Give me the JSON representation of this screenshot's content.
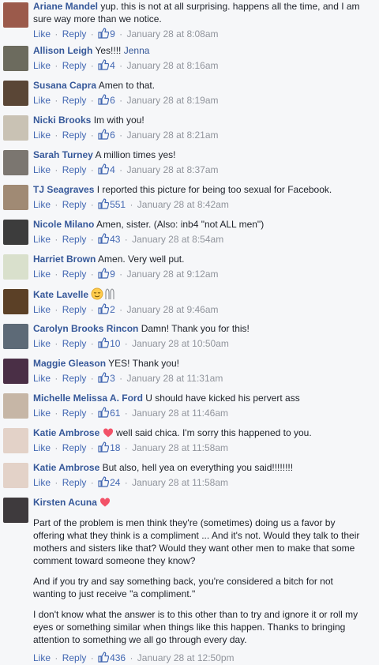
{
  "actions": {
    "like": "Like",
    "reply": "Reply",
    "sep": "·"
  },
  "comments": [
    {
      "author": "Ariane Mandel",
      "text": "yup. this is not at all surprising. happens all the time, and I am sure way more than we notice.",
      "likes": "9",
      "time": "January 28 at 8:08am",
      "avatar": "#9b5a4b"
    },
    {
      "author": "Allison Leigh",
      "text": "Yes!!!!",
      "mention": "Jenna",
      "likes": "4",
      "time": "January 28 at 8:16am",
      "avatar": "#6c6b5e"
    },
    {
      "author": "Susana Capra",
      "text": "Amen to that.",
      "likes": "6",
      "time": "January 28 at 8:19am",
      "avatar": "#5a4636"
    },
    {
      "author": "Nicki Brooks",
      "text": "Im with you!",
      "likes": "6",
      "time": "January 28 at 8:21am",
      "avatar": "#c9c2b4"
    },
    {
      "author": "Sarah Turney",
      "text": "A million times yes!",
      "likes": "4",
      "time": "January 28 at 8:37am",
      "avatar": "#7b7670"
    },
    {
      "author": "TJ Seagraves",
      "text": "I reported this picture for being too sexual for Facebook.",
      "likes": "551",
      "time": "January 28 at 8:42am",
      "avatar": "#a08a74"
    },
    {
      "author": "Nicole Milano",
      "text": "Amen, sister. (Also: inb4 \"not ALL men\")",
      "likes": "43",
      "time": "January 28 at 8:54am",
      "avatar": "#3c3c3c"
    },
    {
      "author": "Harriet Brown",
      "text": "Amen. Very well put.",
      "likes": "9",
      "time": "January 28 at 9:12am",
      "avatar": "#d9e0cc"
    },
    {
      "author": "Kate Lavelle",
      "text": "",
      "likes": "2",
      "time": "January 28 at 9:46am",
      "avatar": "#5b4026"
    },
    {
      "author": "Carolyn Brooks Rincon",
      "text": "Damn! Thank you for this!",
      "likes": "10",
      "time": "January 28 at 10:50am",
      "avatar": "#5d6a77"
    },
    {
      "author": "Maggie Gleason",
      "text": "YES! Thank you!",
      "likes": "3",
      "time": "January 28 at 11:31am",
      "avatar": "#4a2f46"
    },
    {
      "author": "Michelle Melissa A. Ford",
      "text": "U should have kicked his pervert ass",
      "likes": "61",
      "time": "January 28 at 11:46am",
      "avatar": "#c6b6a6"
    },
    {
      "author": "Katie Ambrose",
      "text": "well said chica. I'm sorry this happened to you.",
      "likes": "18",
      "time": "January 28 at 11:58am",
      "avatar": "#e3d2c8",
      "heart": true
    },
    {
      "author": "Katie Ambrose",
      "text": "But also, hell yea on everything you said!!!!!!!!",
      "likes": "24",
      "time": "January 28 at 11:58am",
      "avatar": "#e3d2c8"
    }
  ],
  "last": {
    "author": "Kirsten Acuna",
    "paragraphs": [
      "Part of the problem is men think they're (sometimes) doing us a favor by offering what they think is a compliment ... And it's not. Would they talk to their mothers and sisters like that? Would they want other men to make that some comment toward someone they know?",
      "And if you try and say something back, you're considered a bitch for not wanting to just receive \"a compliment.\"",
      "I don't know what the answer is to this other than to try and ignore it or roll my eyes or something similar when things like this happen. Thanks to bringing attention to something we all go through every day."
    ],
    "likes": "436",
    "time": "January 28 at 12:50pm",
    "avatar": "#3e3a3d"
  }
}
